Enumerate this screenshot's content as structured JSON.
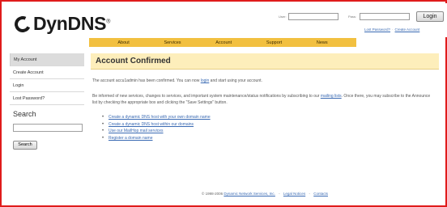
{
  "header": {
    "logo_text": "DynDNS",
    "logo_mark": "®"
  },
  "login": {
    "user_label": "User:",
    "pass_label": "Pass:",
    "user_value": "",
    "pass_value": "",
    "button": "Login",
    "lost_password": "Lost Password?",
    "create_account": "Create Account",
    "separator": "·"
  },
  "nav": {
    "items": [
      "About",
      "Services",
      "Account",
      "Support",
      "News"
    ]
  },
  "sidebar": {
    "items": [
      "My Account",
      "Create Account",
      "Login",
      "Lost Password?"
    ],
    "search_title": "Search",
    "search_value": "",
    "search_button": "Search"
  },
  "main": {
    "title": "Account Confirmed",
    "para1_before": "The account ",
    "para1_account": "accu1admin",
    "para1_middle": " has been confirmed. You can now ",
    "para1_link": "login",
    "para1_after": " and start using your account.",
    "para2_before": "Be informed of new services, changes to services, and important system maintenance/status notifications by subscribing to our ",
    "para2_link": "mailing lists",
    "para2_after": ". Once there, you may subscribe to the Announce list by checking the appropriate box and clicking the \"Save Settings\" button.",
    "links": [
      "Create a dynamic DNS host with your own domain name",
      "Create a dynamic DNS host within our domains",
      "Use our MailHop mail services",
      "Register a domain name"
    ]
  },
  "footer": {
    "copyright": "© 1998-2006",
    "company": "Dynamic Network Services, Inc.",
    "legal": "Legal Notices",
    "contact": "Contacts",
    "separator": "-"
  },
  "colors": {
    "frame": "#e01b1b",
    "nav_bg": "#f2c040",
    "title_bg": "#fdeebb",
    "link": "#3a6ab3"
  }
}
